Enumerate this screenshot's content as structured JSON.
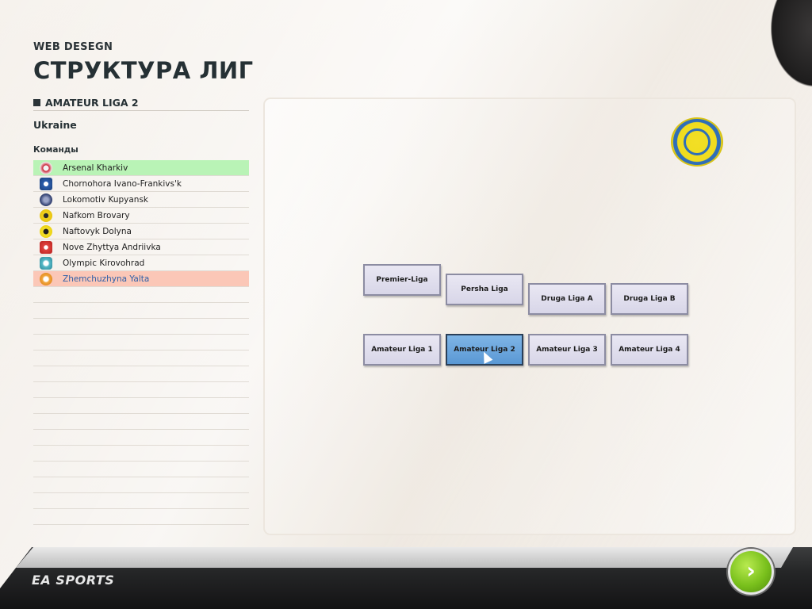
{
  "header": {
    "top_label": "WEB DESEGN",
    "title": "СТРУКТУРА ЛИГ"
  },
  "selected_league": {
    "name": "AMATEUR LIGA 2",
    "country": "Ukraine",
    "teams_label": "Команды",
    "teams": [
      {
        "name": "Arsenal Kharkiv",
        "highlight": "green"
      },
      {
        "name": "Chornohora Ivano-Frankivs'k",
        "highlight": "none"
      },
      {
        "name": "Lokomotiv Kupyansk",
        "highlight": "none"
      },
      {
        "name": "Nafkom Brovary",
        "highlight": "none"
      },
      {
        "name": "Naftovyk Dolyna",
        "highlight": "none"
      },
      {
        "name": "Nove Zhyttya Andriivka",
        "highlight": "none"
      },
      {
        "name": "Olympic Kirovohrad",
        "highlight": "none"
      },
      {
        "name": "Zhemchuzhyna  Yalta",
        "highlight": "red"
      }
    ]
  },
  "pyramid": {
    "nodes": [
      {
        "id": "premier",
        "label": "Premier-Liga"
      },
      {
        "id": "persha",
        "label": "Persha Liga"
      },
      {
        "id": "druga_a",
        "label": "Druga Liga A"
      },
      {
        "id": "druga_b",
        "label": "Druga Liga B"
      },
      {
        "id": "amateur_1",
        "label": "Amateur Liga 1"
      },
      {
        "id": "amateur_2",
        "label": "Amateur Liga 2",
        "selected": true
      },
      {
        "id": "amateur_3",
        "label": "Amateur Liga 3"
      },
      {
        "id": "amateur_4",
        "label": "Amateur Liga 4"
      }
    ]
  },
  "footer": {
    "brand": "EA SPORTS",
    "next_icon": "chevron-right-icon"
  },
  "colors": {
    "green_row": "#b9f3b6",
    "red_row": "#fbc7b7",
    "selected_node": "#5a98d4",
    "next_button": "#79c01c"
  }
}
